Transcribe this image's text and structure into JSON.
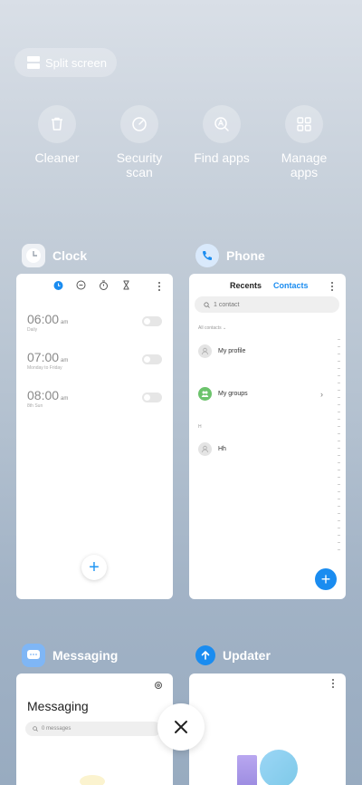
{
  "split_screen": {
    "label": "Split screen"
  },
  "tools": [
    {
      "label": "Cleaner",
      "icon": "trash-icon"
    },
    {
      "label": "Security\nscan",
      "icon": "security-scan-icon"
    },
    {
      "label": "Find apps",
      "icon": "find-apps-icon"
    },
    {
      "label": "Manage\napps",
      "icon": "grid-icon"
    }
  ],
  "apps": {
    "clock": {
      "name": "Clock",
      "alarms": [
        {
          "time": "06:00",
          "ampm": "am",
          "repeat": "Daily"
        },
        {
          "time": "07:00",
          "ampm": "am",
          "repeat": "Monday to Friday"
        },
        {
          "time": "08:00",
          "ampm": "am",
          "repeat": "8th Sun"
        }
      ]
    },
    "phone": {
      "name": "Phone",
      "tab_recents": "Recents",
      "tab_contacts": "Contacts",
      "search_placeholder": "1 contact",
      "all_contacts": "All contacts",
      "my_profile": "My profile",
      "my_groups": "My groups",
      "section_letter": "H",
      "contact": "Hh"
    },
    "messaging": {
      "name": "Messaging",
      "title": "Messaging",
      "search_placeholder": "0 messages"
    },
    "updater": {
      "name": "Updater"
    }
  },
  "colors": {
    "accent": "#1a8cf0"
  }
}
